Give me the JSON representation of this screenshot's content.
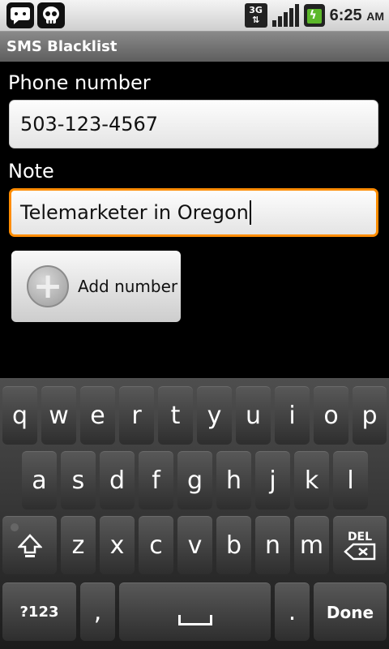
{
  "status_bar": {
    "time": "6:25",
    "ampm": "AM",
    "network": "3G",
    "icons": [
      "chat-icon",
      "skull-icon",
      "network-3g-icon",
      "signal-icon",
      "battery-charging-icon"
    ]
  },
  "app": {
    "title": "SMS Blacklist"
  },
  "form": {
    "phone_label": "Phone number",
    "phone_value": "503-123-4567",
    "note_label": "Note",
    "note_value": "Telemarketer in Oregon",
    "add_button_label": "Add number"
  },
  "keyboard": {
    "row1": [
      "q",
      "w",
      "e",
      "r",
      "t",
      "y",
      "u",
      "i",
      "o",
      "p"
    ],
    "row2": [
      "a",
      "s",
      "d",
      "f",
      "g",
      "h",
      "j",
      "k",
      "l"
    ],
    "row3": [
      "z",
      "x",
      "c",
      "v",
      "b",
      "n",
      "m"
    ],
    "del_label": "DEL",
    "symbols_label": "?123",
    "comma_label": ",",
    "period_label": ".",
    "done_label": "Done"
  },
  "colors": {
    "focus_border": "#ff8c00",
    "title_bar": "#6e6e6e",
    "keyboard_bg": "#2a2a2a"
  }
}
